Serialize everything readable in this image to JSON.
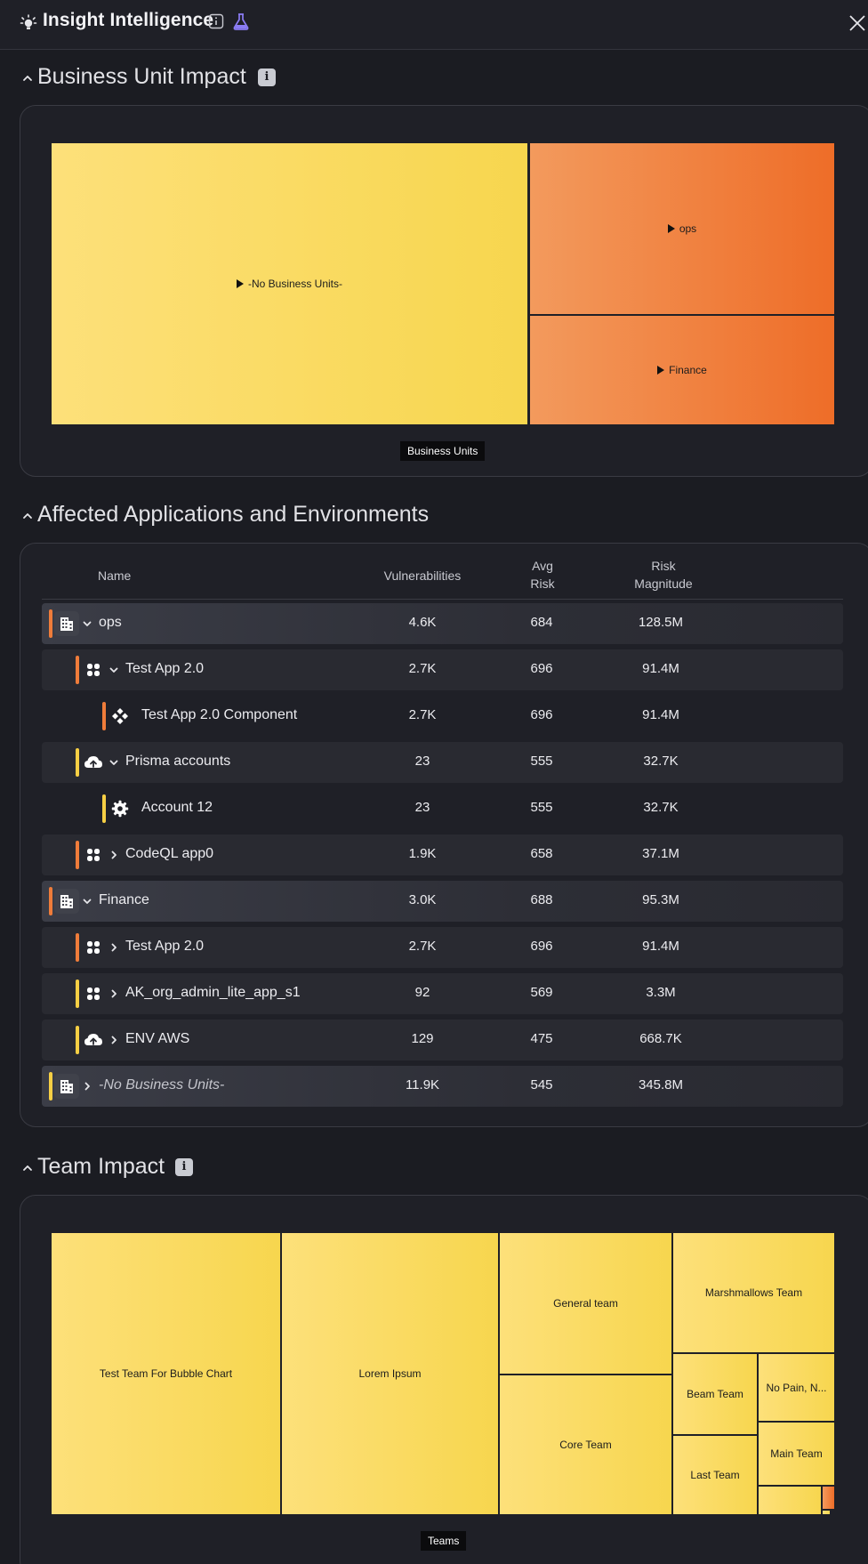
{
  "header": {
    "title": "Insight Intelligence",
    "icons": [
      "lightbulb-icon",
      "info-icon",
      "flask-icon",
      "close-icon"
    ]
  },
  "business_unit_impact": {
    "title": "Business Unit Impact",
    "axis_label": "Business Units",
    "colors": {
      "yellow": "#f7d64e",
      "orange": "#ee6d28"
    },
    "tiles": [
      {
        "label": "-No Business Units-",
        "color": "yellow"
      },
      {
        "label": "ops",
        "color": "orange"
      },
      {
        "label": "Finance",
        "color": "orange"
      }
    ]
  },
  "affected_apps": {
    "title": "Affected Applications and Environments",
    "columns": {
      "name": "Name",
      "vulnerabilities": "Vulnerabilities",
      "avg_risk_1": "Avg",
      "avg_risk_2": "Risk",
      "risk_mag_1": "Risk",
      "risk_mag_2": "Magnitude"
    },
    "rows": [
      {
        "name": "ops",
        "vulns": "4.6K",
        "avg_risk": "684",
        "magnitude": "128.5M",
        "icon": "building-icon",
        "accent": "orange",
        "expanded": true
      },
      {
        "name": "Test App 2.0",
        "vulns": "2.7K",
        "avg_risk": "696",
        "magnitude": "91.4M",
        "icon": "apps-icon",
        "accent": "orange",
        "expanded": true
      },
      {
        "name": "Test App 2.0 Component",
        "vulns": "2.7K",
        "avg_risk": "696",
        "magnitude": "91.4M",
        "icon": "component-icon",
        "accent": "orange"
      },
      {
        "name": "Prisma accounts",
        "vulns": "23",
        "avg_risk": "555",
        "magnitude": "32.7K",
        "icon": "cloud-upload-icon",
        "accent": "yellow",
        "expanded": true
      },
      {
        "name": "Account 12",
        "vulns": "23",
        "avg_risk": "555",
        "magnitude": "32.7K",
        "icon": "gear-icon",
        "accent": "yellow"
      },
      {
        "name": "CodeQL app0",
        "vulns": "1.9K",
        "avg_risk": "658",
        "magnitude": "37.1M",
        "icon": "apps-icon",
        "accent": "orange",
        "expanded": false
      },
      {
        "name": "Finance",
        "vulns": "3.0K",
        "avg_risk": "688",
        "magnitude": "95.3M",
        "icon": "building-icon",
        "accent": "orange",
        "expanded": true
      },
      {
        "name": "Test App 2.0",
        "vulns": "2.7K",
        "avg_risk": "696",
        "magnitude": "91.4M",
        "icon": "apps-icon",
        "accent": "orange",
        "expanded": false
      },
      {
        "name": "AK_org_admin_lite_app_s1",
        "vulns": "92",
        "avg_risk": "569",
        "magnitude": "3.3M",
        "icon": "apps-icon",
        "accent": "yellow",
        "expanded": false
      },
      {
        "name": "ENV AWS",
        "vulns": "129",
        "avg_risk": "475",
        "magnitude": "668.7K",
        "icon": "cloud-upload-icon",
        "accent": "yellow",
        "expanded": false
      },
      {
        "name": "-No Business Units-",
        "vulns": "11.9K",
        "avg_risk": "545",
        "magnitude": "345.8M",
        "icon": "building-icon",
        "accent": "yellow",
        "expanded": false
      }
    ]
  },
  "team_impact": {
    "title": "Team Impact",
    "axis_label": "Teams",
    "tiles": [
      {
        "label": "Test Team For Bubble Chart",
        "color": "yellow"
      },
      {
        "label": "Lorem Ipsum",
        "color": "yellow"
      },
      {
        "label": "General team",
        "color": "yellow"
      },
      {
        "label": "Core Team",
        "color": "yellow"
      },
      {
        "label": "Marshmallows Team",
        "color": "yellow"
      },
      {
        "label": "Beam Team",
        "color": "yellow"
      },
      {
        "label": "Last Team",
        "color": "yellow"
      },
      {
        "label": "No Pain, N...",
        "color": "yellow"
      },
      {
        "label": "Main Team",
        "color": "yellow"
      },
      {
        "label": "",
        "color": "yellow"
      },
      {
        "label": "",
        "color": "orange"
      },
      {
        "label": "",
        "color": "yellow"
      }
    ]
  }
}
